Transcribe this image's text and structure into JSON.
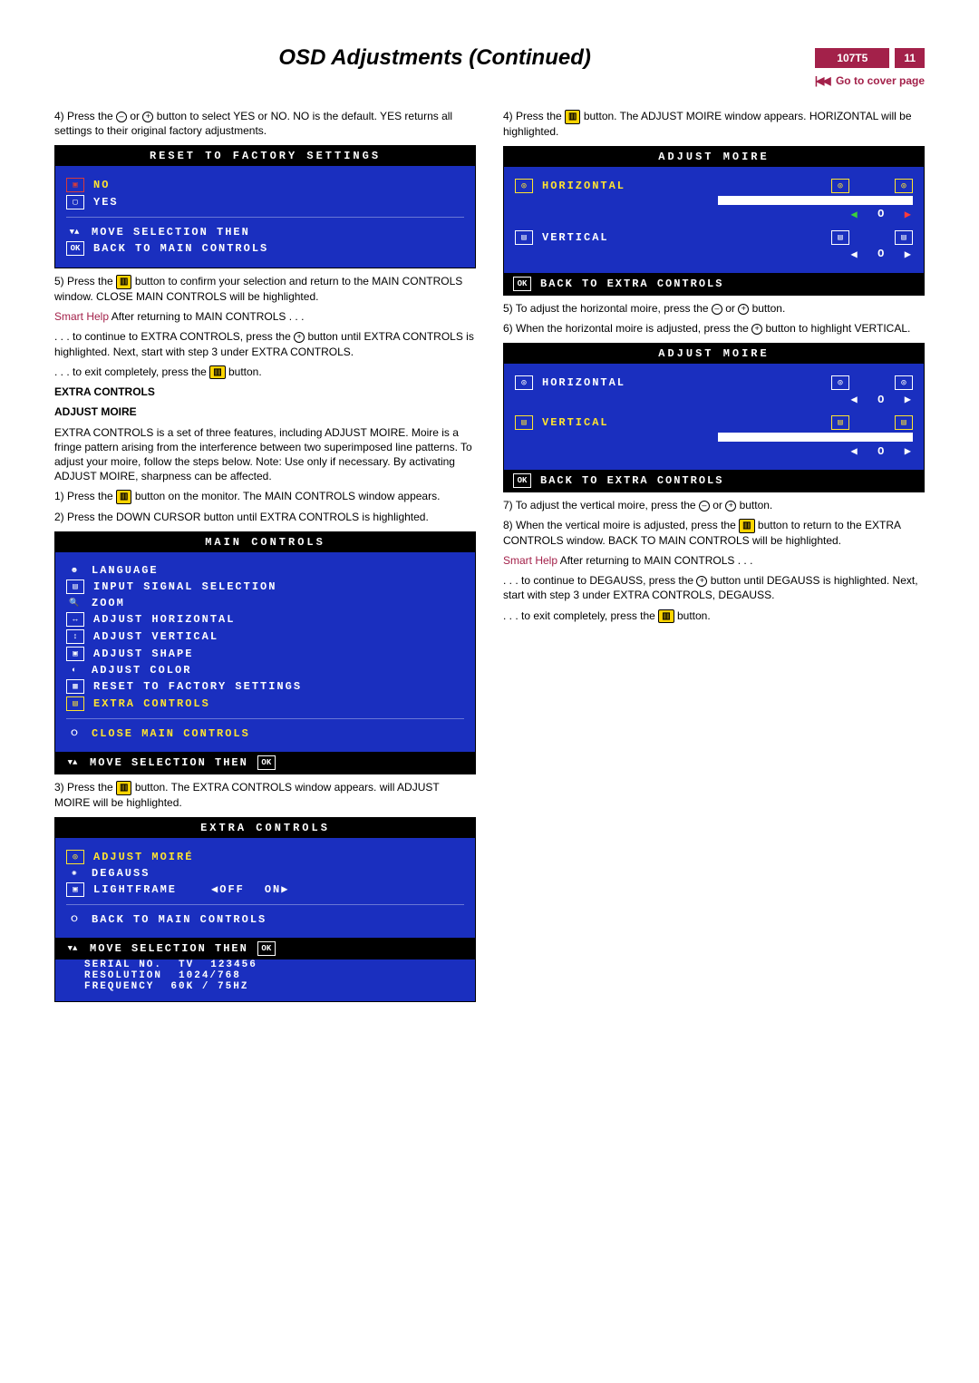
{
  "header": {
    "title": "OSD Adjustments (Continued)",
    "model": "107T5",
    "page": "11",
    "cover": "Go to cover page"
  },
  "left": {
    "p4": "4) Press the ",
    "p4b": " or ",
    "p4c": " button to select YES or NO. NO is the default. YES returns all settings to their original factory adjustments.",
    "reset_title": "RESET TO FACTORY SETTINGS",
    "reset_no": "NO",
    "reset_yes": "YES",
    "reset_hint1": "MOVE SELECTION THEN",
    "reset_hint2": "BACK TO MAIN CONTROLS",
    "p5a": "5) Press the ",
    "p5b": " button to confirm your selection and return to the MAIN CONTROLS window. CLOSE MAIN CONTROLS will be highlighted.",
    "sh1": "Smart Help",
    "sh1b": "  After returning to MAIN CONTROLS . . .",
    "c1a": ". . . to continue to EXTRA CONTROLS, press the ",
    "c1b": " button until EXTRA CONTROLS is highlighted. Next, start with step 3 under EXTRA CONTROLS.",
    "c2a": ". . . to exit completely, press the ",
    "c2b": " button.",
    "h_extra": "EXTRA CONTROLS",
    "h_adjmoire": "ADJUST MOIRE",
    "para_extra": "EXTRA CONTROLS is a set of three features, including ADJUST MOIRE. Moire is a fringe pattern arising from the interference between two superimposed line patterns. To adjust your moire, follow the steps below. Note: Use only if necessary. By activating ADJUST MOIRE, sharpness can be affected.",
    "s1a": "1) Press the ",
    "s1b": " button on the monitor. The MAIN CONTROLS window appears.",
    "s2": "2) Press the DOWN CURSOR button until EXTRA CONTROLS is highlighted.",
    "main_title": "MAIN CONTROLS",
    "main_items": [
      "LANGUAGE",
      "INPUT SIGNAL SELECTION",
      "ZOOM",
      "ADJUST HORIZONTAL",
      "ADJUST VERTICAL",
      "ADJUST SHAPE",
      "ADJUST COLOR",
      "RESET TO FACTORY SETTINGS",
      "EXTRA CONTROLS"
    ],
    "main_close": "CLOSE MAIN CONTROLS",
    "main_hint": "MOVE SELECTION THEN",
    "s3a": "3) Press the ",
    "s3b": " button. The EXTRA CONTROLS window appears.  will ADJUST MOIRE will be highlighted.",
    "extra_title": "EXTRA CONTROLS",
    "extra_item1": "ADJUST MOIRÉ",
    "extra_item2": "DEGAUSS",
    "extra_item3": "LIGHTFRAME",
    "extra_off": "OFF",
    "extra_on": "ON",
    "extra_back": "BACK TO MAIN CONTROLS",
    "extra_hint": "MOVE SELECTION THEN",
    "extra_serial_l": "SERIAL NO.",
    "extra_serial_m": "TV",
    "extra_serial_r": "123456",
    "extra_res_l": "RESOLUTION",
    "extra_res_r": "1024/768",
    "extra_freq_l": "FREQUENCY",
    "extra_freq_r": "60K / 75HZ"
  },
  "right": {
    "p4a": "4) Press the ",
    "p4b": " button. The ADJUST MOIRE window appears. HORIZONTAL will be highlighted.",
    "adj_title": "ADJUST MOIRE",
    "adj_h": "HORIZONTAL",
    "adj_v": "VERTICAL",
    "adj_back": "BACK TO EXTRA CONTROLS",
    "p5a": "5) To adjust the horizontal moire, press the ",
    "p5b": " or ",
    "p5c": " button.",
    "p6a": "6) When the horizontal moire is adjusted, press the ",
    "p6b": " button to highlight VERTICAL.",
    "p7a": "7) To adjust the vertical moire, press the ",
    "p7b": " or ",
    "p7c": " button.",
    "p8a": "8) When the vertical moire is adjusted, press the ",
    "p8b": " button to return to the EXTRA CONTROLS window. BACK TO MAIN CONTROLS will be highlighted.",
    "sh1": "Smart Help",
    "sh1b": "  After returning to MAIN CONTROLS . . .",
    "c1a": ". . . to continue to DEGAUSS, press the ",
    "c1b": " button until DEGAUSS is highlighted. Next, start with step 3 under EXTRA CONTROLS, DEGAUSS.",
    "c2a": ". . . to exit completely, press the ",
    "c2b": " button."
  }
}
